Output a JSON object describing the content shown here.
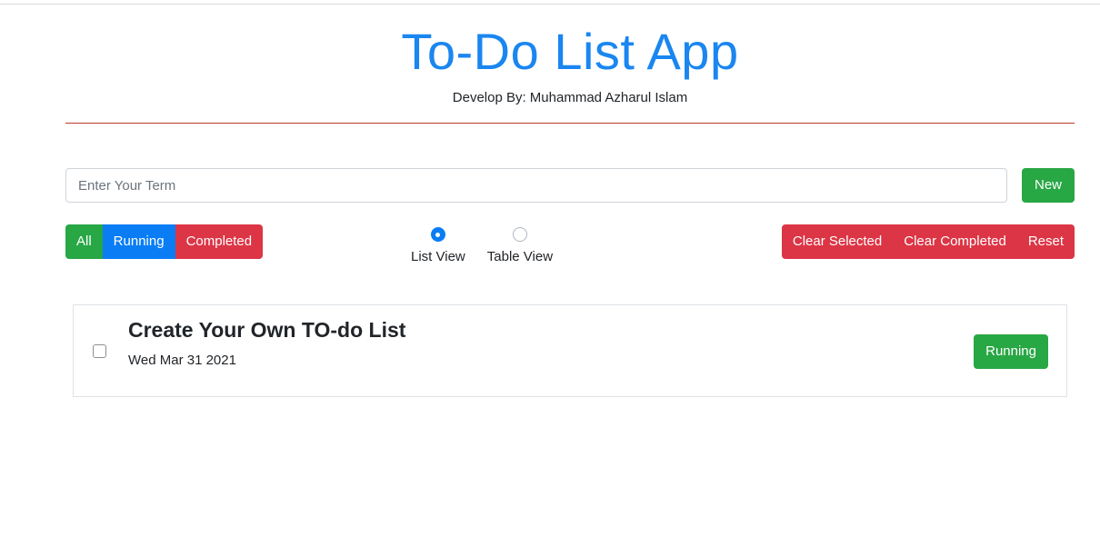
{
  "header": {
    "title": "To-Do List App",
    "subtitle": "Develop By: Muhammad Azharul Islam"
  },
  "search": {
    "placeholder": "Enter Your Term",
    "value": ""
  },
  "toolbar": {
    "new_label": "New"
  },
  "filters": [
    {
      "label": "All",
      "color": "#28a745"
    },
    {
      "label": "Running",
      "color": "#0a7df5"
    },
    {
      "label": "Completed",
      "color": "#dc3545"
    }
  ],
  "view": {
    "options": [
      {
        "label": "List View",
        "selected": true
      },
      {
        "label": "Table View",
        "selected": false
      }
    ]
  },
  "actions": [
    {
      "label": "Clear Selected"
    },
    {
      "label": "Clear Completed"
    },
    {
      "label": "Reset"
    }
  ],
  "todos": [
    {
      "title": "Create Your Own TO-do List",
      "date": "Wed Mar 31 2021",
      "status": "Running",
      "checked": false
    }
  ],
  "colors": {
    "accent": "#1a86f0",
    "success": "#28a745",
    "primary": "#0a7df5",
    "danger": "#dc3545",
    "divider": "#c0392b"
  }
}
